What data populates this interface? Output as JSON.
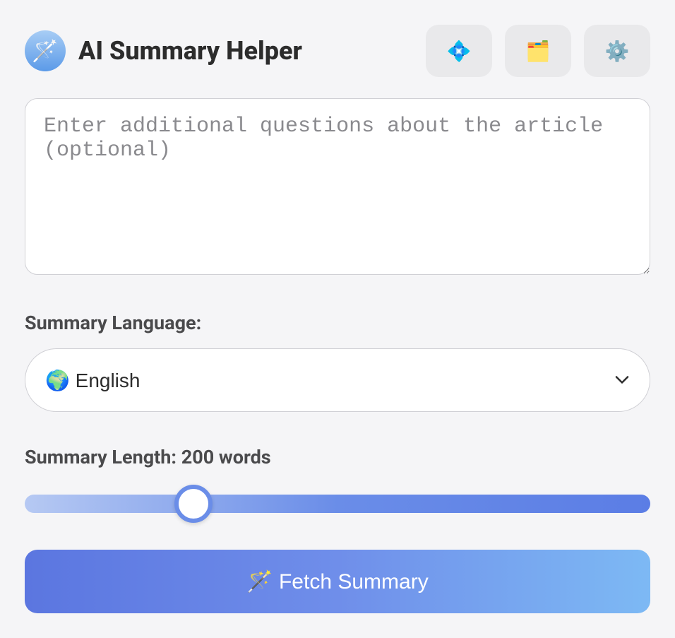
{
  "header": {
    "title": "AI Summary Helper",
    "logo_emoji": "🪄",
    "icon_buttons": [
      {
        "name": "sparkle-button",
        "emoji": "💠"
      },
      {
        "name": "folder-button",
        "emoji": "🗂️"
      },
      {
        "name": "settings-button",
        "emoji": "⚙️"
      }
    ]
  },
  "questions": {
    "placeholder": "Enter additional questions about the article (optional)",
    "value": ""
  },
  "language": {
    "label": "Summary Language:",
    "selected": "🌍 English"
  },
  "length": {
    "label": "Summary Length: 200 words",
    "value": 200,
    "min": 50,
    "max": 600
  },
  "fetch": {
    "label": "🪄 Fetch Summary"
  }
}
